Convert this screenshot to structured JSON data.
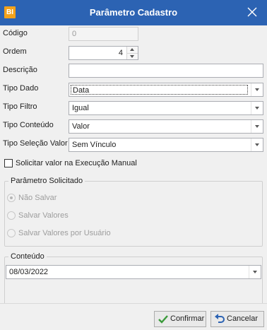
{
  "window": {
    "app_icon_text": "BI",
    "title": "Parâmetro Cadastro"
  },
  "form": {
    "codigo": {
      "label": "Código",
      "value": "0"
    },
    "ordem": {
      "label": "Ordem",
      "value": "4"
    },
    "descricao": {
      "label": "Descrição",
      "value": ""
    },
    "tipo_dado": {
      "label": "Tipo Dado",
      "value": "Data"
    },
    "tipo_filtro": {
      "label": "Tipo Filtro",
      "value": "Igual"
    },
    "tipo_conteudo": {
      "label": "Tipo Conteúdo",
      "value": "Valor"
    },
    "tipo_selecao_valor": {
      "label": "Tipo Seleção Valor",
      "value": "Sem Vínculo"
    },
    "solicitar_valor": {
      "label": "Solicitar valor na Execução Manual",
      "checked": false
    }
  },
  "parametro_solicitado": {
    "title": "Parâmetro Solicitado",
    "options": [
      {
        "label": "Não Salvar",
        "checked": true
      },
      {
        "label": "Salvar Valores",
        "checked": false
      },
      {
        "label": "Salvar Valores por Usuário",
        "checked": false
      }
    ]
  },
  "conteudo": {
    "title": "Conteúdo",
    "value": "08/03/2022"
  },
  "footer": {
    "confirm_label": "Confirmar",
    "cancel_label": "Cancelar"
  },
  "colors": {
    "titlebar": "#2c63b3",
    "app_icon": "#f3a21b",
    "confirm_check": "#3a9a3a",
    "cancel_arrow": "#2c63b3"
  },
  "icons": {
    "close": "close-icon",
    "confirm": "check-icon",
    "cancel": "undo-icon"
  }
}
